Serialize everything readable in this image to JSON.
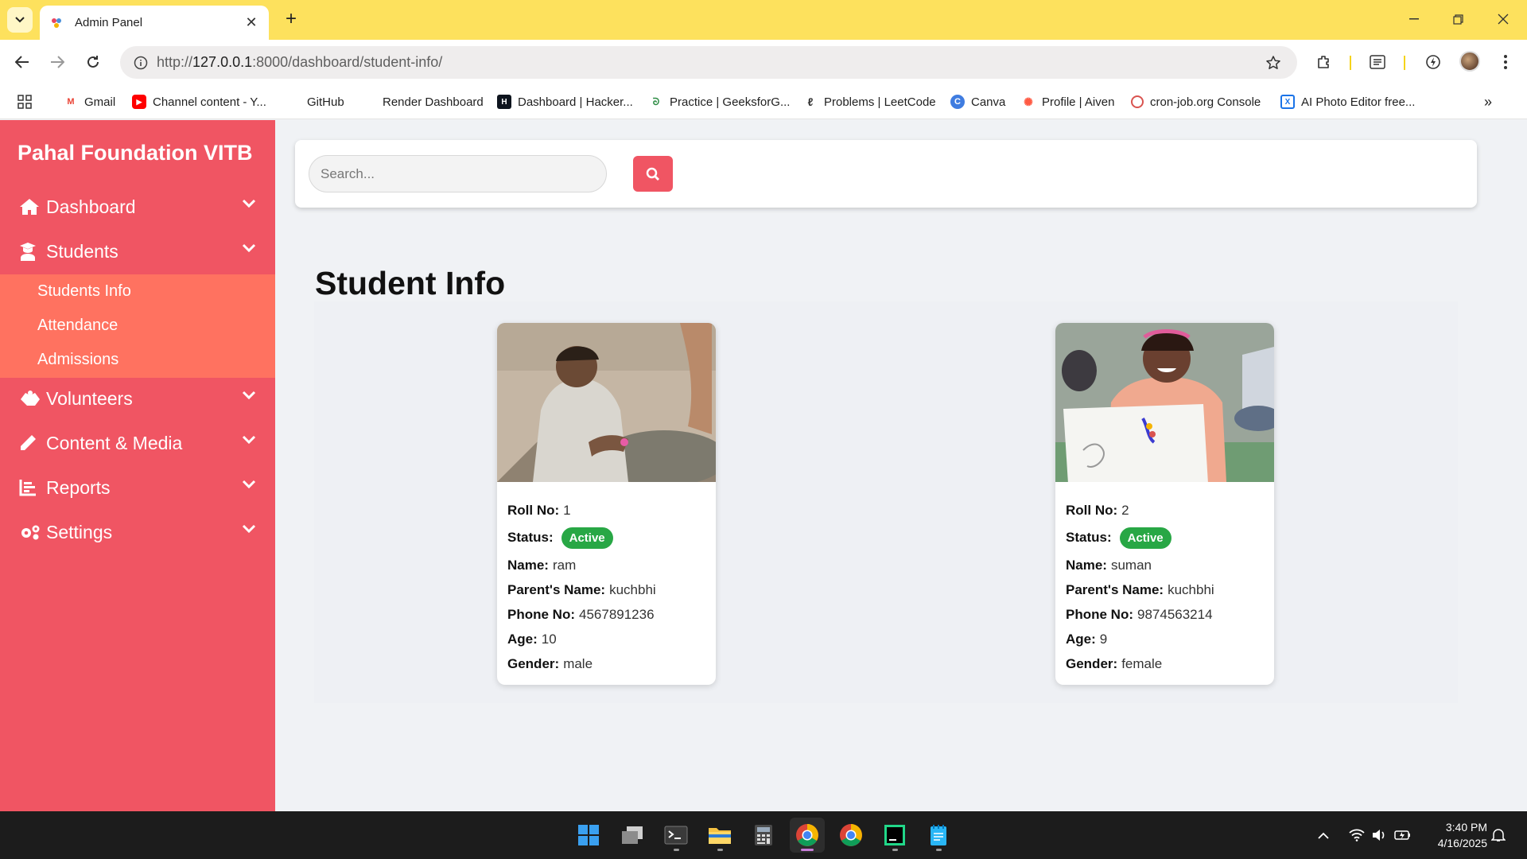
{
  "browser": {
    "tab_title": "Admin Panel",
    "url_prefix": "http://",
    "url_host": "127.0.0.1",
    "url_path": ":8000/dashboard/student-info/"
  },
  "bookmarks": [
    {
      "label": "Gmail",
      "icon": "gmail-icon",
      "color": "#ea4335"
    },
    {
      "label": "Channel content - Y...",
      "icon": "youtube-icon",
      "color": "#ff0000"
    },
    {
      "label": "GitHub",
      "icon": "github-icon",
      "color": "#24292e"
    },
    {
      "label": "Render Dashboard",
      "icon": "render-icon",
      "color": "#000000"
    },
    {
      "label": "Dashboard | Hacker...",
      "icon": "hackerrank-icon",
      "color": "#0e141e"
    },
    {
      "label": "Practice | GeeksforG...",
      "icon": "geeksforgeeks-icon",
      "color": "#2f8d46"
    },
    {
      "label": "Problems | LeetCode",
      "icon": "leetcode-icon",
      "color": "#ffa116"
    },
    {
      "label": "Canva",
      "icon": "canva-icon",
      "color": "#00c4cc"
    },
    {
      "label": "Profile | Aiven",
      "icon": "aiven-icon",
      "color": "#ff5a43"
    },
    {
      "label": "cron-job.org Console",
      "icon": "cronjob-icon",
      "color": "#d9534f"
    },
    {
      "label": "AI Photo Editor free...",
      "icon": "photo-editor-icon",
      "color": "#1a73e8"
    }
  ],
  "sidebar": {
    "brand": "Pahal Foundation VITB",
    "items": [
      {
        "label": "Dashboard",
        "icon": "home-icon"
      },
      {
        "label": "Students",
        "icon": "student-icon"
      },
      {
        "label": "Volunteers",
        "icon": "hands-icon"
      },
      {
        "label": "Content & Media",
        "icon": "pencil-icon"
      },
      {
        "label": "Reports",
        "icon": "chart-icon"
      },
      {
        "label": "Settings",
        "icon": "gears-icon"
      }
    ],
    "students_submenu": [
      "Students Info",
      "Attendance",
      "Admissions"
    ]
  },
  "search": {
    "placeholder": "Search..."
  },
  "page": {
    "title": "Student Info"
  },
  "labels": {
    "roll": "Roll No:",
    "status": "Status:",
    "name": "Name:",
    "parent": "Parent's Name:",
    "phone": "Phone No:",
    "age": "Age:",
    "gender": "Gender:"
  },
  "students": [
    {
      "roll": "1",
      "status": "Active",
      "name": "ram",
      "parent": "kuchbhi",
      "phone": "4567891236",
      "age": "10",
      "gender": "male"
    },
    {
      "roll": "2",
      "status": "Active",
      "name": "suman",
      "parent": "kuchbhi",
      "phone": "9874563214",
      "age": "9",
      "gender": "female"
    }
  ],
  "taskbar": {
    "time": "3:40 PM",
    "date": "4/16/2025"
  },
  "colors": {
    "sidebar": "#f05563",
    "submenu": "#ff7260",
    "badge": "#28a745",
    "chrome_frame": "#fde15d"
  }
}
